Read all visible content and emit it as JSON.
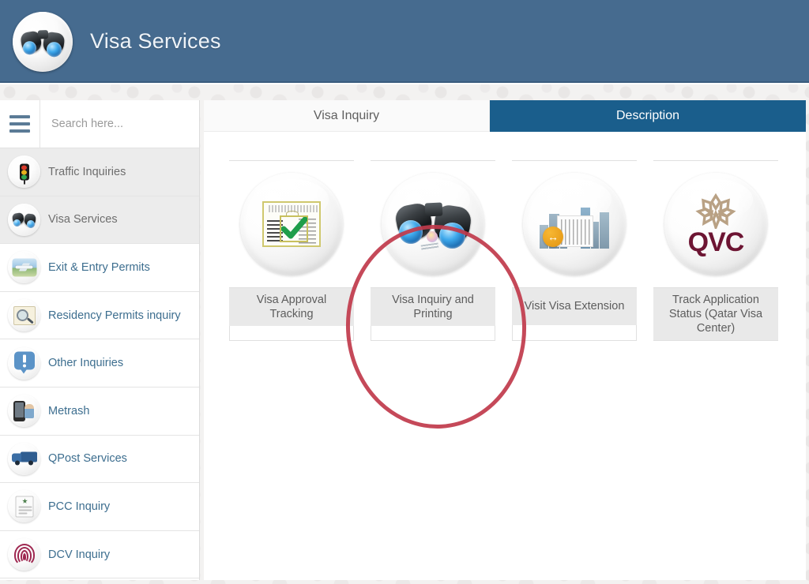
{
  "header": {
    "title": "Visa Services",
    "logo_icon": "binoculars-icon",
    "background_color": "#466b8f"
  },
  "sidebar": {
    "menu_icon": "hamburger-menu-icon",
    "search": {
      "placeholder": "Search here...",
      "value": "",
      "icon": "search-input"
    },
    "items": [
      {
        "label": "Traffic Inquiries",
        "icon": "traffic-light-icon",
        "active": true
      },
      {
        "label": "Visa Services",
        "icon": "binoculars-icon",
        "active": true
      },
      {
        "label": "Exit & Entry Permits",
        "icon": "airplane-icon",
        "active": false
      },
      {
        "label": "Residency Permits inquiry",
        "icon": "magnifier-icon",
        "active": false
      },
      {
        "label": "Other Inquiries",
        "icon": "exclamation-icon",
        "active": false
      },
      {
        "label": "Metrash",
        "icon": "mobile-phone-icon",
        "active": false
      },
      {
        "label": "QPost Services",
        "icon": "delivery-truck-icon",
        "active": false
      },
      {
        "label": "PCC Inquiry",
        "icon": "certificate-icon",
        "active": false
      },
      {
        "label": "DCV Inquiry",
        "icon": "fingerprint-icon",
        "active": false
      }
    ]
  },
  "main": {
    "tabs": [
      {
        "label": "Visa Inquiry",
        "active": false
      },
      {
        "label": "Description",
        "active": true
      }
    ],
    "active_tab_color": "#1a5e8c",
    "cards": [
      {
        "label": "Visa Approval Tracking",
        "icon": "visa-document-check-icon"
      },
      {
        "label": "Visa Inquiry and Printing",
        "icon": "binoculars-icon"
      },
      {
        "label": "Visit Visa Extension",
        "icon": "city-skyline-extension-icon"
      },
      {
        "label": "Track Application Status (Qatar Visa Center)",
        "icon": "qvc-logo-icon"
      }
    ]
  },
  "annotation": {
    "shape": "ellipse",
    "color": "#c0394b",
    "targets_card": "Visa Inquiry and Printing"
  },
  "qvc": {
    "wordmark": "QVC"
  },
  "extension_badge": {
    "glyph": "↔"
  }
}
